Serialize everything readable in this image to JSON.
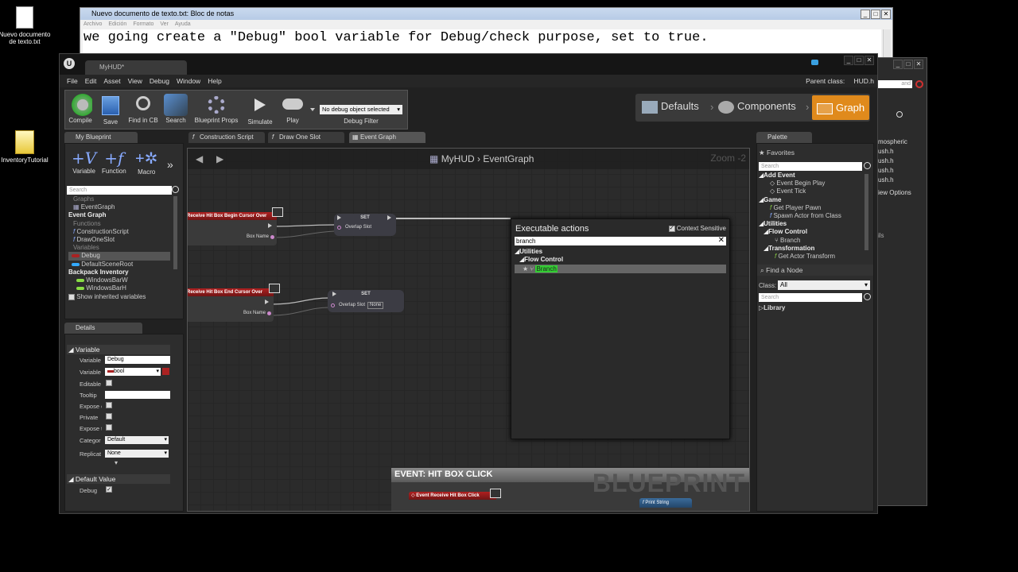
{
  "desktop": {
    "icons": [
      {
        "label": "Nuevo documento de texto.txt"
      },
      {
        "label": "InventoryTutorial"
      }
    ]
  },
  "notepad": {
    "title": "Nuevo documento de texto.txt: Bloc de notas",
    "menu": [
      "Archivo",
      "Edición",
      "Formato",
      "Ver",
      "Ayuda"
    ],
    "text": "we going create a \"Debug\" bool variable for Debug/check purpose, set to true."
  },
  "ue_back": {
    "items": [
      "mospheric",
      "ush.h",
      "ush.h",
      "ush.h",
      "ush.h",
      "iew Options",
      "ils"
    ],
    "search_placeholder": "and"
  },
  "ue": {
    "tab_title": "MyHUD*",
    "menu": [
      "File",
      "Edit",
      "Asset",
      "View",
      "Debug",
      "Window",
      "Help"
    ],
    "parent_class_label": "Parent class:",
    "parent_class_value": "HUD.h",
    "toolbar": {
      "compile": "Compile",
      "save": "Save",
      "find": "Find in CB",
      "search": "Search",
      "blueprint_props": "Blueprint Props",
      "simulate": "Simulate",
      "play": "Play",
      "debug_select": "No debug object selected",
      "debug_filter": "Debug Filter"
    },
    "modes": {
      "defaults": "Defaults",
      "components": "Components",
      "graph": "Graph"
    },
    "my_blueprint": {
      "tab": "My Blueprint",
      "add": {
        "variable": "Variable",
        "function": "Function",
        "macro": "Macro"
      },
      "search_placeholder": "Search",
      "graphs_header": "Graphs",
      "event_graph_item": "EventGraph",
      "event_graph_header": "Event Graph",
      "functions_header": "Functions",
      "functions": [
        "ConstructionScript",
        "DrawOneSlot"
      ],
      "variables_header": "Variables",
      "variables": [
        "Debug",
        "DefaultSceneRoot"
      ],
      "backpack": "Backpack Inventory",
      "backpack_vars": [
        "WindowsBarW",
        "WindowsBarH"
      ],
      "show_inherited": "Show inherited variables"
    },
    "details": {
      "tab": "Details",
      "section_variable": "Variable",
      "rows": {
        "name_label": "Variable",
        "name_value": "Debug",
        "type_label": "Variable",
        "type_value": "bool",
        "editable": "Editable",
        "tooltip": "Tooltip",
        "expose1": "Expose c",
        "private": "Private",
        "expose2": "Expose t",
        "category_label": "Categor",
        "category_value": "Default",
        "replication_label": "Replicat",
        "replication_value": "None"
      },
      "section_default": "Default Value",
      "default_label": "Debug"
    },
    "graph_tabs": [
      "Construction Script",
      "Draw One Slot",
      "Event Graph"
    ],
    "breadcrumb": {
      "root": "MyHUD",
      "leaf": "EventGraph"
    },
    "zoom": "Zoom -2",
    "nodes": {
      "begin_cursor": "Receive Hit Box Begin Cursor Over",
      "end_cursor": "Receive Hit Box End Cursor Over",
      "box_name": "Box Name",
      "set": "SET",
      "overlap_slot": "Overlap Slot",
      "none": "None",
      "hit_box_click_comment": "EVENT: HIT BOX CLICK",
      "event_hit_box_click": "Event Receive Hit Box Click",
      "print_string": "Print String",
      "watermark": "BLUEPRINT"
    },
    "context_menu": {
      "title": "Executable actions",
      "context_sensitive": "Context Sensitive",
      "search_value": "branch",
      "categories": [
        "Utilities",
        "Flow Control"
      ],
      "result": "Branch"
    },
    "palette": {
      "tab": "Palette",
      "favorites": "Favorites",
      "search_placeholder": "Search",
      "tree": {
        "add_event": "Add Event",
        "begin_play": "Event Begin Play",
        "tick": "Event Tick",
        "game": "Game",
        "get_player_pawn": "Get Player Pawn",
        "spawn_actor": "Spawn Actor from Class",
        "utilities": "Utilities",
        "flow_control": "Flow Control",
        "branch": "Branch",
        "transformation": "Transformation",
        "get_actor_transform": "Get Actor Transform"
      },
      "find_node": "Find a Node",
      "class_label": "Class:",
      "class_value": "All",
      "library": "Library"
    }
  }
}
